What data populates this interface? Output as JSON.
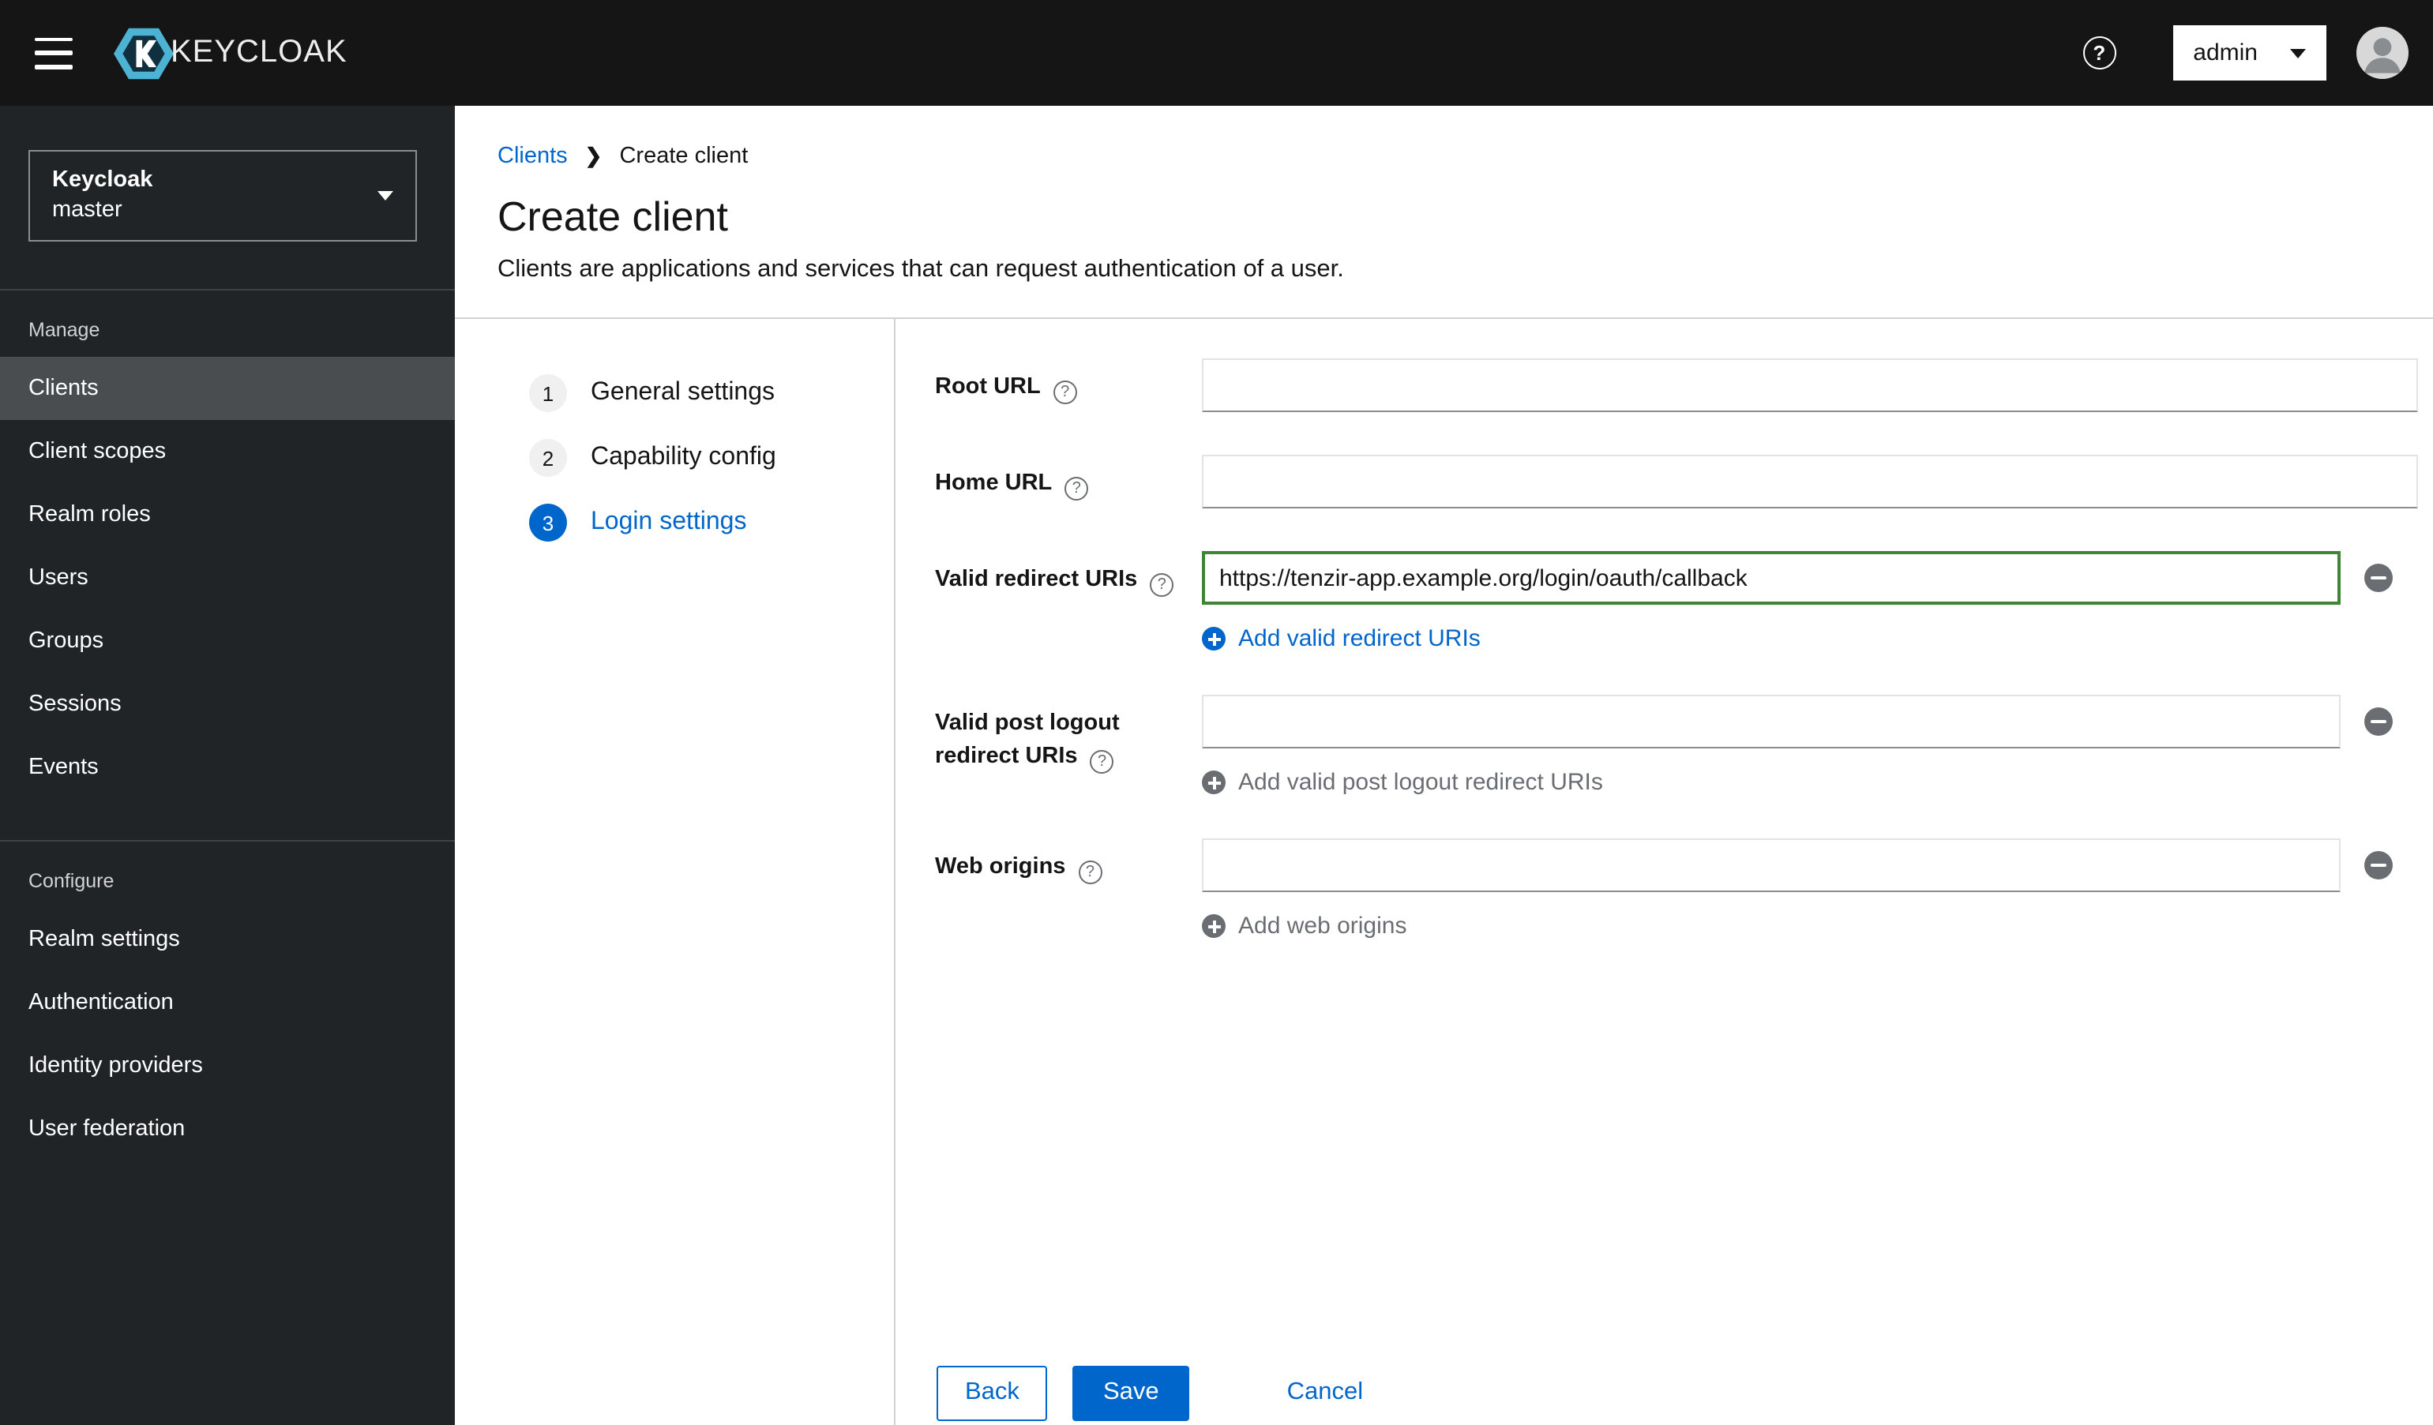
{
  "topbar": {
    "brand_text": "KEYCLOAK",
    "user_menu": {
      "label": "admin"
    }
  },
  "icons": {
    "hamburger": "menu",
    "help": "question-circle",
    "avatar": "user-silhouette",
    "plus": "plus-circle",
    "minus": "minus-circle",
    "caret": "caret-down"
  },
  "sidebar": {
    "realm_selector": {
      "title": "Keycloak",
      "realm": "master"
    },
    "sections": [
      {
        "heading": "Manage",
        "items": [
          {
            "label": "Clients",
            "active": true
          },
          {
            "label": "Client scopes",
            "active": false
          },
          {
            "label": "Realm roles",
            "active": false
          },
          {
            "label": "Users",
            "active": false
          },
          {
            "label": "Groups",
            "active": false
          },
          {
            "label": "Sessions",
            "active": false
          },
          {
            "label": "Events",
            "active": false
          }
        ]
      },
      {
        "heading": "Configure",
        "items": [
          {
            "label": "Realm settings",
            "active": false
          },
          {
            "label": "Authentication",
            "active": false
          },
          {
            "label": "Identity providers",
            "active": false
          },
          {
            "label": "User federation",
            "active": false
          }
        ]
      }
    ]
  },
  "breadcrumb": {
    "parent": "Clients",
    "current": "Create client"
  },
  "page_header": {
    "title": "Create client",
    "description": "Clients are applications and services that can request authentication of a user."
  },
  "wizard": {
    "steps": [
      {
        "number": "1",
        "label": "General settings",
        "active": false
      },
      {
        "number": "2",
        "label": "Capability config",
        "active": false
      },
      {
        "number": "3",
        "label": "Login settings",
        "active": true
      }
    ]
  },
  "form": {
    "root_url": {
      "label": "Root URL",
      "value": ""
    },
    "home_url": {
      "label": "Home URL",
      "value": ""
    },
    "redirect_uris": {
      "label": "Valid redirect URIs",
      "value": "https://tenzir-app.example.org/login/oauth/callback",
      "add_label": "Add valid redirect URIs"
    },
    "post_logout_uris": {
      "label_line1": "Valid post logout",
      "label_line2": "redirect URIs",
      "value": "",
      "add_label": "Add valid post logout redirect URIs"
    },
    "web_origins": {
      "label": "Web origins",
      "value": "",
      "add_label": "Add web origins"
    }
  },
  "actions": {
    "back": "Back",
    "save": "Save",
    "cancel": "Cancel"
  },
  "colors": {
    "accent": "#0066cc",
    "success_border": "#3e8635",
    "masthead_bg": "#151515",
    "sidebar_bg": "#212427",
    "active_nav_bg": "#4a4d50"
  }
}
